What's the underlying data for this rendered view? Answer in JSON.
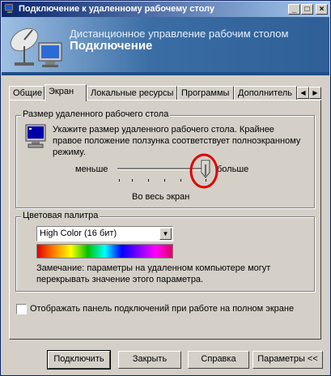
{
  "window": {
    "title": "Подключение к удаленному рабочему столу",
    "controls": {
      "minimize": "_",
      "maximize": "□",
      "close": "×"
    }
  },
  "banner": {
    "line1": "Дистанционное управление рабочим столом",
    "line2": "Подключение"
  },
  "tabs": [
    {
      "label": "Общие"
    },
    {
      "label": "Экран"
    },
    {
      "label": "Локальные ресурсы"
    },
    {
      "label": "Программы"
    },
    {
      "label": "Дополнитель"
    }
  ],
  "tab_scroll": {
    "left": "◀",
    "right": "▶"
  },
  "screen_size": {
    "legend": "Размер удаленного рабочего стола",
    "description": "Укажите размер удаленного рабочего стола. Крайнее правое положение ползунка соответствует полноэкранному режиму.",
    "min_label": "меньше",
    "max_label": "больше",
    "current_value": "Во весь экран",
    "slider_position_percent": 100
  },
  "color_palette": {
    "legend": "Цветовая палитра",
    "selected": "High Color (16 бит)",
    "note": "Замечание: параметры на удаленном компьютере могут перекрывать значение этого параметра."
  },
  "options": {
    "show_connection_bar": {
      "label": "Отображать панель подключений при работе на полном экране",
      "checked": false
    }
  },
  "buttons": {
    "connect": "Подключить",
    "close": "Закрыть",
    "help": "Справка",
    "options": "Параметры <<"
  },
  "colors": {
    "titlebar_start": "#0a246a",
    "titlebar_end": "#a6caf0",
    "annotation_circle": "#e00000"
  }
}
